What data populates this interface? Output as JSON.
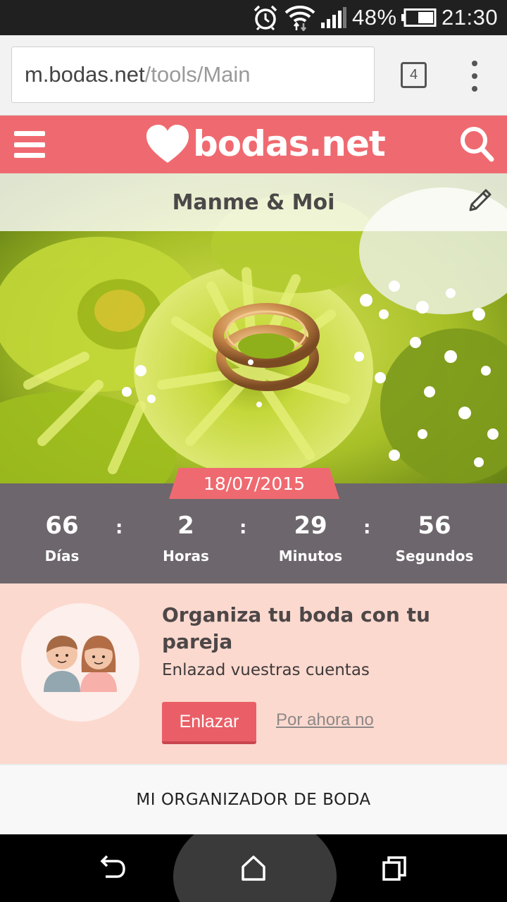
{
  "status_bar": {
    "battery_percent": "48%",
    "time": "21:30",
    "icons": [
      "alarm-clock-icon",
      "wifi-icon",
      "signal-icon",
      "battery-icon"
    ]
  },
  "browser": {
    "url_host": "m.bodas.net",
    "url_path": "/tools/Main",
    "tab_count": "4"
  },
  "header": {
    "brand": "bodas.net",
    "brand_color": "#ef6a70"
  },
  "hero": {
    "couple_name": "Manme & Moi"
  },
  "wedding": {
    "date": "18/07/2015"
  },
  "countdown": {
    "days": "66",
    "days_label": "Días",
    "hours": "2",
    "hours_label": "Horas",
    "minutes": "29",
    "minutes_label": "Minutos",
    "seconds": "56",
    "seconds_label": "Segundos",
    "separator": ":"
  },
  "partner_card": {
    "title": "Organiza tu boda con tu pareja",
    "subtitle": "Enlazad vuestras cuentas",
    "primary_button": "Enlazar",
    "secondary_link": "Por ahora no",
    "background": "#fcd9cf"
  },
  "organizer": {
    "title": "MI ORGANIZADOR DE BODA"
  },
  "nav": {
    "icons": [
      "back-icon",
      "home-icon",
      "recents-icon"
    ]
  }
}
